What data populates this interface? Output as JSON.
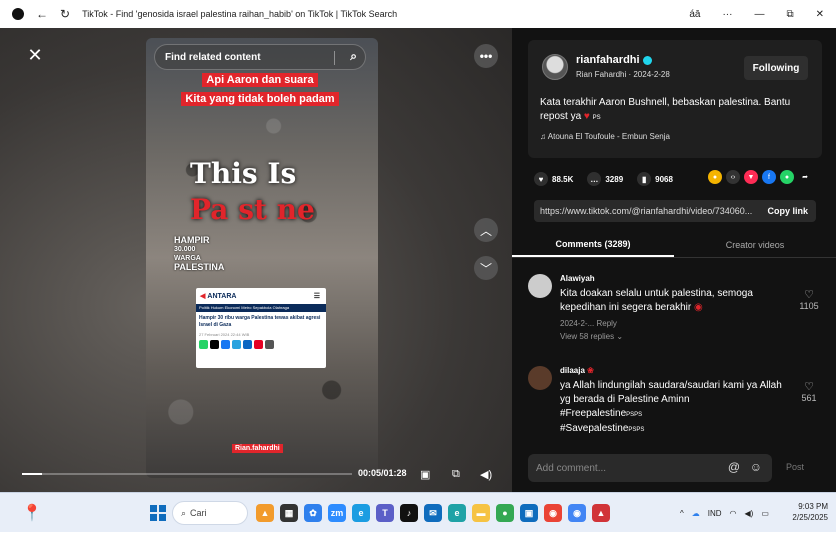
{
  "browser": {
    "tab_title": "TikTok - Find 'genosida israel palestina raihan_habib' on TikTok | TikTok Search",
    "controls": {
      "lang_label": "áā",
      "more": "···",
      "minimize": "—",
      "restore": "⧉",
      "close": "✕"
    }
  },
  "video": {
    "search_placeholder": "Find related content",
    "caption_line1": "Api Aaron dan suara",
    "caption_line2": "Kita yang tidak boleh padam",
    "overlay_line1": "This Is",
    "overlay_line2": "Pa  st ne",
    "hampir_line1": "HAMPIR",
    "hampir_line2": "30.000 WARGA",
    "hampir_line3": "PALESTINA",
    "news_logo": "ANTARA",
    "news_nav": "Politik  Hukum  Ekonomi  Metro  Sepakbola  Olahraga",
    "news_headline": "Hampir 30 ribu warga Palestina tewas akibat agresi Israel di Gaza",
    "news_date": "27 Februari 2024 22:44 WIB",
    "username_tag": "Rian.fahardhi",
    "time": "00:05/01:28",
    "progress_fraction": 0.06
  },
  "author": {
    "name": "rianfahardhi",
    "display_meta": "Rian Fahardhi · 2024-2-28",
    "follow_label": "Following",
    "desc_text": "Kata terakhir Aaron Bushnell, bebaskan palestina. Bantu repost ya",
    "desc_suffix": "PS",
    "music": "Atouna El Toufoule - Embun Senja"
  },
  "stats": {
    "likes": "88.5K",
    "comments": "3289",
    "saves": "9068"
  },
  "link": {
    "url": "https://www.tiktok.com/@rianfahardhi/video/734060...",
    "copy_label": "Copy link"
  },
  "tabs": {
    "comments": "Comments (3289)",
    "creator": "Creator videos"
  },
  "comments": [
    {
      "name": "Alawiyah",
      "text": "Kita doakan selalu untuk palestina, semoga kepedihan ini segera berakhir",
      "meta": "2024-2-...   Reply",
      "replies": "View 58 replies",
      "likes": "1105"
    },
    {
      "name": "dilaaja",
      "text": "ya Allah lindungilah saudara/saudari kami ya Allah yg berada di Palestine Aminn",
      "tag1": "#Freepalestine",
      "tag2": "#Savepalestine",
      "tag_suffix": "PSPS",
      "likes": "561"
    }
  ],
  "composer": {
    "placeholder": "Add comment...",
    "post_label": "Post"
  },
  "taskbar": {
    "search_label": "Cari",
    "lang": "IND",
    "time": "9:03 PM",
    "date": "2/25/2025"
  }
}
